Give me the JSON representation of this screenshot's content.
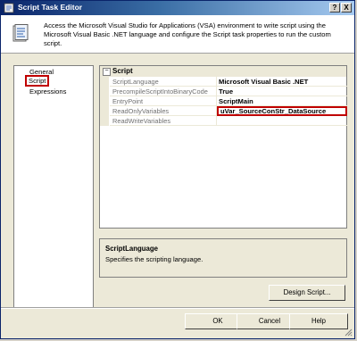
{
  "window": {
    "title": "Script Task Editor",
    "controls": {
      "help": "?",
      "close": "X"
    }
  },
  "header": {
    "description": "Access the Microsoft Visual Studio for Applications (VSA) environment to write script using the Microsoft Visual Basic .NET language and configure the Script task properties to run the custom script."
  },
  "nav": {
    "items": [
      {
        "label": "General",
        "selected": false
      },
      {
        "label": "Script",
        "selected": true
      },
      {
        "label": "Expressions",
        "selected": false
      }
    ]
  },
  "properties": {
    "category": "Script",
    "rows": [
      {
        "name": "ScriptLanguage",
        "value": "Microsoft Visual Basic .NET"
      },
      {
        "name": "PrecompileScriptIntoBinaryCode",
        "value": "True"
      },
      {
        "name": "EntryPoint",
        "value": "ScriptMain"
      },
      {
        "name": "ReadOnlyVariables",
        "value": "uVar_SourceConStr_DataSource",
        "highlighted": true
      },
      {
        "name": "ReadWriteVariables",
        "value": ""
      }
    ]
  },
  "description_panel": {
    "title": "ScriptLanguage",
    "text": "Specifies the scripting language."
  },
  "buttons": {
    "design_script": "Design Script...",
    "ok": "OK",
    "cancel": "Cancel",
    "help": "Help"
  },
  "colors": {
    "highlight_border": "#c00000",
    "title_gradient_start": "#0a246a"
  }
}
